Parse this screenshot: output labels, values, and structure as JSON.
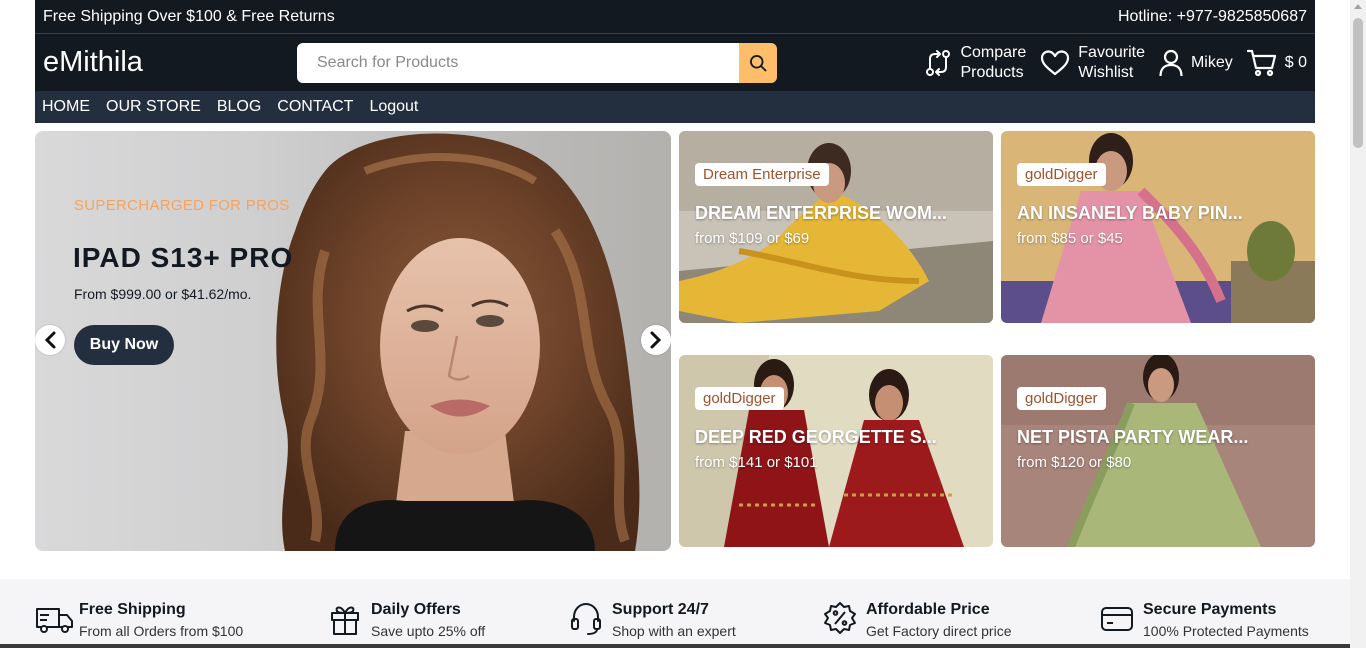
{
  "top_strip": {
    "left_text": "Free Shipping Over $100 & Free Returns",
    "hotline": "Hotline: +977-9825850687"
  },
  "header": {
    "logo": "eMithila",
    "search_placeholder": "Search for Products",
    "compare": [
      "Compare",
      "Products"
    ],
    "favourite": [
      "Favourite",
      "Wishlist"
    ],
    "user": "Mikey",
    "cart_total": "$ 0"
  },
  "nav": [
    "HOME",
    "OUR STORE",
    "BLOG",
    "CONTACT",
    "Logout"
  ],
  "hero": {
    "subtitle": "SUPERCHARGED FOR PROS",
    "title": "IPAD S13+ PRO",
    "price": "From $999.00 or $41.62/mo.",
    "button": "Buy Now"
  },
  "cards": [
    {
      "tag": "Dream Enterprise",
      "title": "DREAM ENTERPRISE WOM...",
      "price": "from $109 or $69"
    },
    {
      "tag": "goldDigger",
      "title": "AN INSANELY BABY PIN...",
      "price": "from $85 or $45"
    },
    {
      "tag": "goldDigger",
      "title": "DEEP RED GEORGETTE S...",
      "price": "from $141 or $101"
    },
    {
      "tag": "goldDigger",
      "title": "NET PISTA PARTY WEAR...",
      "price": "from $120 or $80"
    }
  ],
  "services": [
    {
      "title": "Free Shipping",
      "subtitle": "From all Orders from $100",
      "icon": "truck-icon"
    },
    {
      "title": "Daily Offers",
      "subtitle": "Save upto 25% off",
      "icon": "gift-icon"
    },
    {
      "title": "Support 24/7",
      "subtitle": "Shop with an expert",
      "icon": "headset-icon"
    },
    {
      "title": "Affordable Price",
      "subtitle": "Get Factory direct price",
      "icon": "discount-badge-icon"
    },
    {
      "title": "Secure Payments",
      "subtitle": "100% Protected Payments",
      "icon": "credit-card-icon"
    }
  ],
  "colors": {
    "dark": "#131921",
    "nav": "#232f3e",
    "accent": "#febd69",
    "hero_sub": "#f7a35c"
  }
}
